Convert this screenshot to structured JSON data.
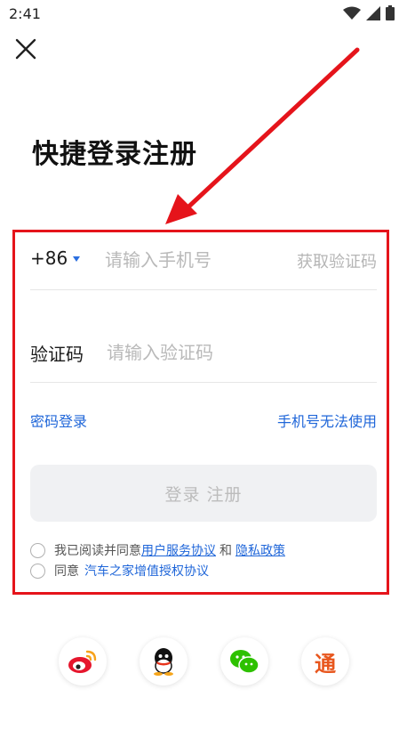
{
  "status_bar": {
    "time": "2:41"
  },
  "title": "快捷登录注册",
  "phone_row": {
    "country_code": "+86",
    "placeholder": "请输入手机号",
    "get_code_label": "获取验证码"
  },
  "code_row": {
    "label": "验证码",
    "placeholder": "请输入验证码"
  },
  "links": {
    "password_login": "密码登录",
    "phone_unavailable": "手机号无法使用"
  },
  "login_button": "登录 注册",
  "agreement_1": {
    "prefix": "我已阅读并同意",
    "link_1": "用户服务协议",
    "connector": "和",
    "link_2": "隐私政策"
  },
  "agreement_2": {
    "prefix": "同意",
    "link": "汽车之家增值授权协议"
  },
  "social_logins": [
    "weibo-icon",
    "qq-icon",
    "wechat-icon",
    "tong-icon"
  ],
  "tong_glyph": "通",
  "colors": {
    "accent": "#1f66d9",
    "highlight": "#e5141b",
    "button_bg": "#f0f1f3"
  }
}
